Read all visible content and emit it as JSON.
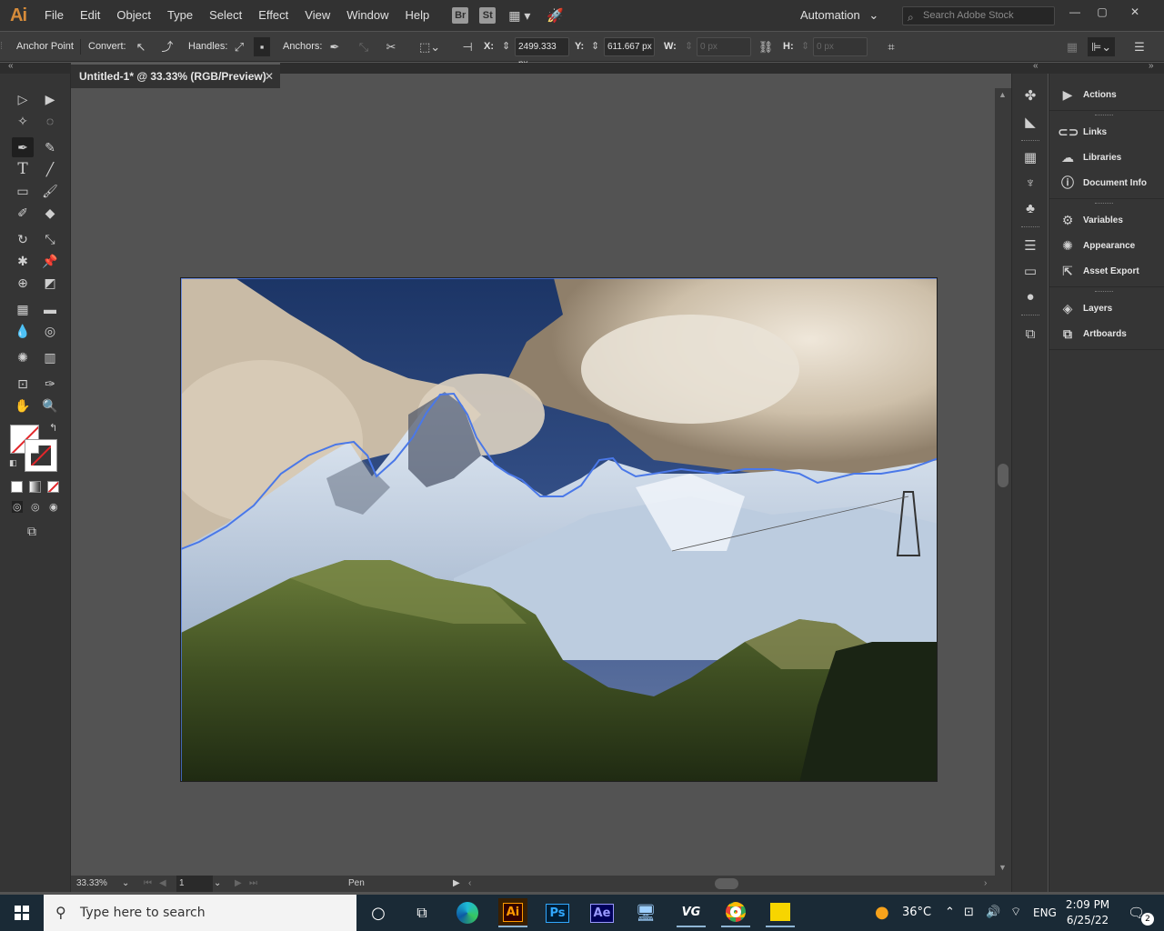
{
  "app": {
    "logo": "Ai",
    "automation_label": "Automation",
    "stock_search_placeholder": "Search Adobe Stock"
  },
  "menu": [
    "File",
    "Edit",
    "Object",
    "Type",
    "Select",
    "Effect",
    "View",
    "Window",
    "Help"
  ],
  "menubar_icons": {
    "bridge": "Br",
    "stock": "St"
  },
  "control_bar": {
    "selection_label": "Anchor Point",
    "convert_label": "Convert:",
    "handles_label": "Handles:",
    "anchors_label": "Anchors:",
    "x_label": "X:",
    "x_value": "2499.333 px",
    "y_label": "Y:",
    "y_value": "611.667 px",
    "w_label": "W:",
    "w_value": "0 px",
    "h_label": "H:",
    "h_value": "0 px"
  },
  "document": {
    "tab_title": "Untitled-1* @ 33.33% (RGB/Preview)"
  },
  "status_bar": {
    "zoom": "33.33%",
    "artboard": "1",
    "tool": "Pen"
  },
  "panels": [
    {
      "label": "Actions",
      "icon": "play-icon"
    },
    {
      "label": "Links",
      "icon": "links-icon"
    },
    {
      "label": "Libraries",
      "icon": "libraries-icon"
    },
    {
      "label": "Document Info",
      "icon": "info-icon"
    },
    {
      "label": "Variables",
      "icon": "variables-icon"
    },
    {
      "label": "Appearance",
      "icon": "appearance-icon"
    },
    {
      "label": "Asset Export",
      "icon": "asset-export-icon"
    },
    {
      "label": "Layers",
      "icon": "layers-icon"
    },
    {
      "label": "Artboards",
      "icon": "artboards-icon"
    }
  ],
  "taskbar": {
    "search_placeholder": "Type here to search",
    "apps": {
      "illustrator": "Ai",
      "photoshop": "Ps",
      "after_effects": "Ae",
      "vg": "VG"
    },
    "temperature": "36°C",
    "language": "ENG",
    "time": "2:09 PM",
    "date": "6/25/22",
    "notifications": "2"
  },
  "colors": {
    "selection_path": "#4a78e8",
    "illustrator_orange": "#ff9a00",
    "photoshop_blue": "#31a8ff",
    "after_effects_purple": "#9999ff"
  }
}
